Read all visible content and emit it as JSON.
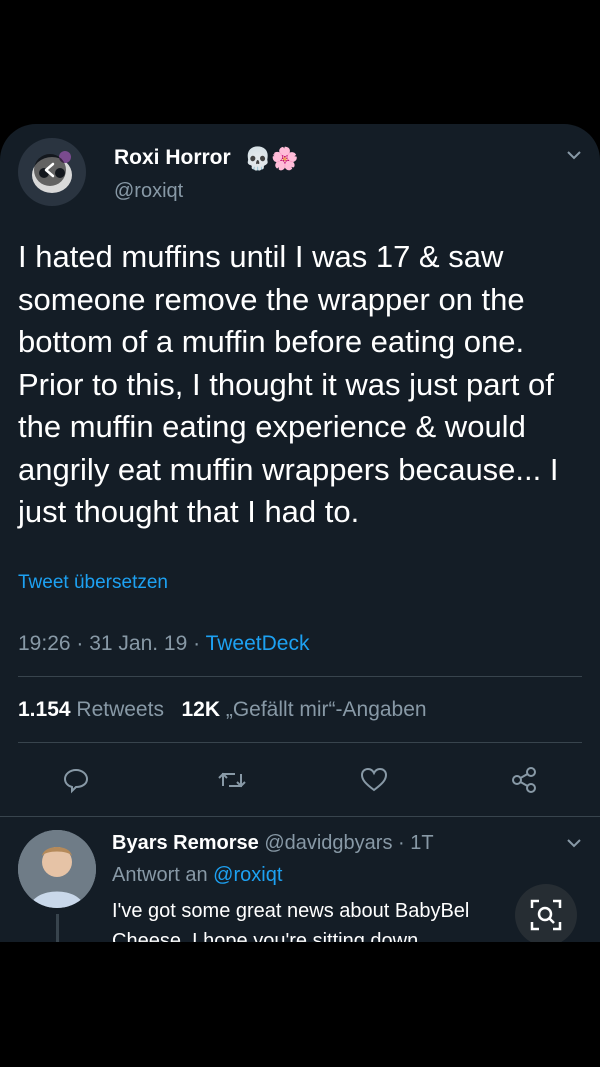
{
  "tweet": {
    "author_name": "Roxi Horror",
    "name_badges": "💀🌸",
    "author_handle": "@roxiqt",
    "text": "I hated muffins until I was 17 & saw someone remove the wrapper on the bottom of a muffin before eating one. Prior to this, I thought it was just part of the muffin eating experience & would angrily eat muffin wrappers because... I just thought that I had to.",
    "translate_label": "Tweet übersetzen",
    "timestamp": "19:26 · 31 Jan. 19 · ",
    "source": "TweetDeck",
    "retweet_count": "1.154",
    "retweet_label": "Retweets",
    "like_count": "12K",
    "like_label": "„Gefällt mir“-Angaben"
  },
  "icons": {
    "back": "back-arrow-icon",
    "menu": "chevron-down-icon",
    "reply": "reply-icon",
    "retweet": "retweet-icon",
    "like": "heart-icon",
    "share": "share-icon",
    "lens": "lens-search-icon"
  },
  "reply": {
    "author_name": "Byars Remorse",
    "author_handle": "@davidgbyars",
    "time": " · 1T",
    "reply_to_label": "Antwort an",
    "reply_to_handle": "@roxiqt",
    "text": "I've got some great news about BabyBel Cheese. I hope you're sitting down"
  },
  "colors": {
    "background": "#141d26",
    "accent": "#1da1f2",
    "muted": "#8899a6",
    "divider": "#38444d"
  }
}
